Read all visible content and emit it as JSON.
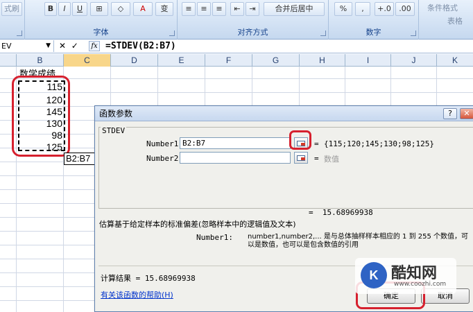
{
  "ribbon": {
    "groups": [
      {
        "label": "字体",
        "buttons": [
          "B",
          "I",
          "U",
          "⊞",
          "◇",
          "A",
          "变"
        ]
      },
      {
        "label": "对齐方式",
        "buttons": [
          "≡",
          "≡",
          "≡",
          "⇤",
          "⇥",
          "合并后居中"
        ]
      },
      {
        "label": "数字",
        "buttons": [
          "%",
          ",",
          "+.0",
          ".00"
        ]
      },
      {
        "label": "",
        "buttons": [
          "条件格式",
          "表格"
        ]
      }
    ],
    "left_label": "式刷"
  },
  "formula_bar": {
    "name_box": "EV",
    "cancel": "✕",
    "enter": "✓",
    "fx": "fx",
    "formula": "=STDEV(B2:B7)"
  },
  "columns": [
    "B",
    "C",
    "D",
    "E",
    "F",
    "G",
    "H",
    "I",
    "J",
    "K"
  ],
  "selected_column": "C",
  "sheet": {
    "header_cell": "数学成绩",
    "values": [
      "115",
      "120",
      "145",
      "130",
      "98",
      "125"
    ],
    "editing_cell": "B2:B7"
  },
  "dialog": {
    "title": "函数参数",
    "help_btn": "?",
    "close_btn": "✕",
    "function_name": "STDEV",
    "args": [
      {
        "label": "Number1",
        "value": "B2:B7",
        "eq": "=",
        "result": "{115;120;145;130;98;125}"
      },
      {
        "label": "Number2",
        "value": "",
        "eq": "=",
        "result": "数值"
      }
    ],
    "total_eq": "=",
    "total_value": "15.68969938",
    "description": "估算基于给定样本的标准偏差(忽略样本中的逻辑值及文本)",
    "arg_desc_label": "Number1:",
    "arg_desc_text_1": "number1,number2,... 是与总体抽样样本相应的 1 到 255 个数值，可",
    "arg_desc_text_2": "以是数值，也可以是包含数值的引用",
    "calc_label": "计算结果 =",
    "calc_value": "15.68969938",
    "help_link": "有关该函数的帮助(H)",
    "ok": "确定",
    "cancel": "取消"
  },
  "watermark": {
    "logo": "K",
    "name": "酷知网",
    "url": "www.coozhi.com"
  },
  "colors": {
    "highlight_ring": "#d6202e",
    "link": "#0033cc",
    "selected_col_header": "#f8d68a"
  }
}
